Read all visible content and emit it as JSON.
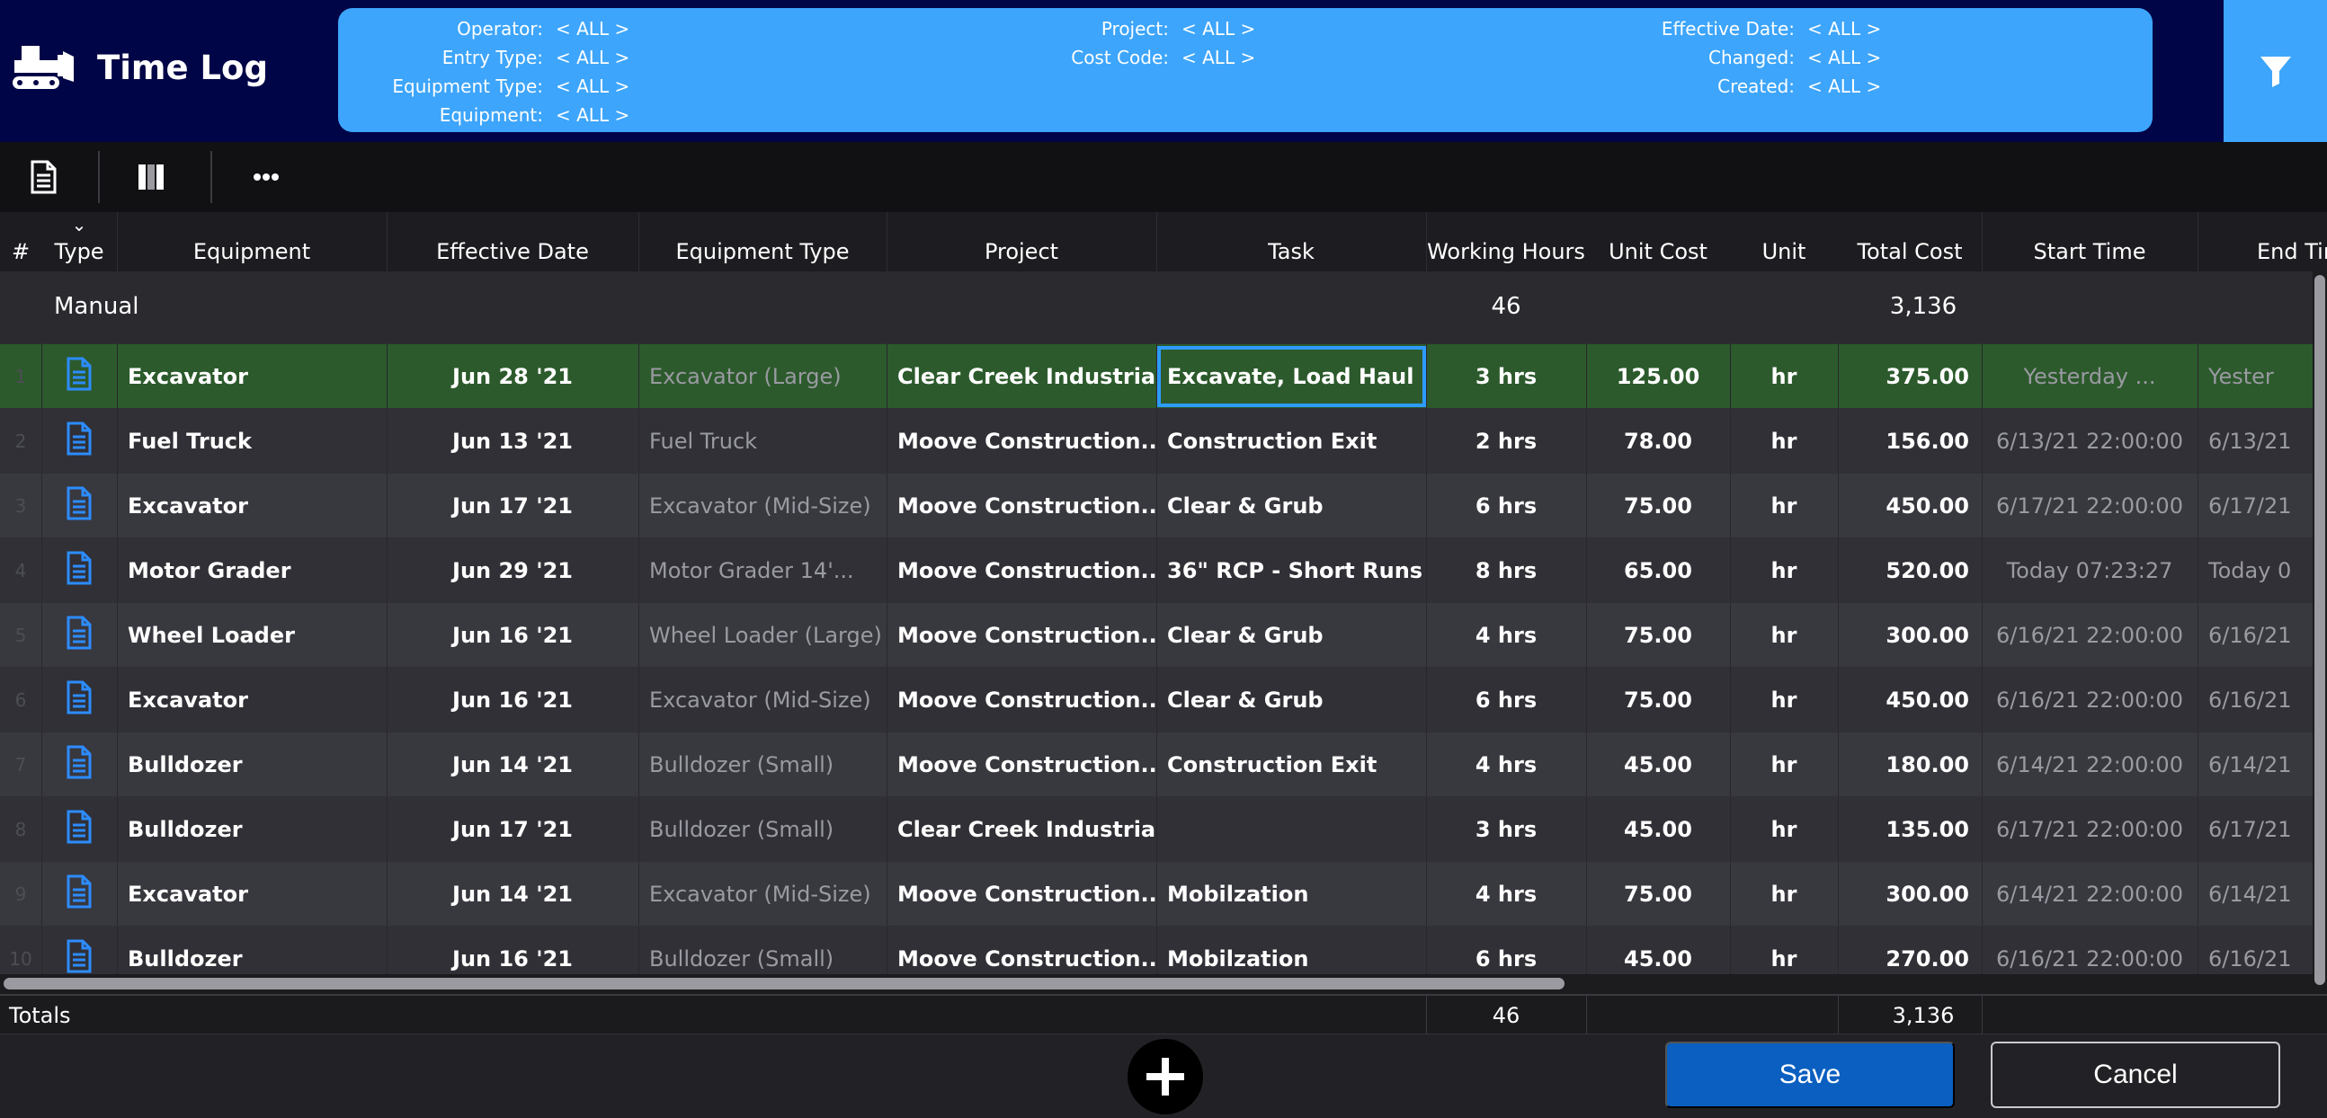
{
  "app": {
    "title": "Time Log"
  },
  "filters": {
    "col1": [
      {
        "label": "Operator:",
        "value": "< ALL >"
      },
      {
        "label": "Entry Type:",
        "value": "< ALL >"
      },
      {
        "label": "Equipment Type:",
        "value": "< ALL >"
      },
      {
        "label": "Equipment:",
        "value": "< ALL >"
      }
    ],
    "col2": [
      {
        "label": "Project:",
        "value": "< ALL >"
      },
      {
        "label": "Cost Code:",
        "value": "< ALL >"
      }
    ],
    "col3": [
      {
        "label": "Effective Date:",
        "value": "< ALL >"
      },
      {
        "label": "Changed:",
        "value": "< ALL >"
      },
      {
        "label": "Created:",
        "value": "< ALL >"
      }
    ]
  },
  "toolbar": {
    "icons": [
      "report-icon",
      "columns-icon",
      "more-icon"
    ]
  },
  "columns": {
    "num": "#",
    "type": "Type",
    "equipment": "Equipment",
    "effective_date": "Effective Date",
    "equipment_type": "Equipment Type",
    "project": "Project",
    "task": "Task",
    "working_hours": "Working Hours",
    "unit_cost": "Unit Cost",
    "unit": "Unit",
    "total_cost": "Total Cost",
    "start_time": "Start Time",
    "end_time": "End Tin"
  },
  "group": {
    "label": "Manual",
    "hours": "46",
    "total": "3,136"
  },
  "rows": [
    {
      "num": "1",
      "equipment": "Excavator",
      "date": "Jun 28 '21",
      "eqtype": "Excavator (Large)",
      "project": "Clear Creek Industrial...",
      "task": "Excavate, Load Haul &...",
      "hours": "3 hrs",
      "unit_cost": "125.00",
      "unit": "hr",
      "total": "375.00",
      "start": "Yesterday   ...",
      "end": "Yester"
    },
    {
      "num": "2",
      "equipment": "Fuel Truck",
      "date": "Jun 13 '21",
      "eqtype": "Fuel Truck",
      "project": "Moove Construction...",
      "task": "Construction Exit",
      "hours": "2 hrs",
      "unit_cost": "78.00",
      "unit": "hr",
      "total": "156.00",
      "start": "6/13/21  22:00:00",
      "end": "6/13/21"
    },
    {
      "num": "3",
      "equipment": "Excavator",
      "date": "Jun 17 '21",
      "eqtype": "Excavator (Mid-Size)",
      "project": "Moove Construction...",
      "task": "Clear & Grub",
      "hours": "6 hrs",
      "unit_cost": "75.00",
      "unit": "hr",
      "total": "450.00",
      "start": "6/17/21  22:00:00",
      "end": "6/17/21"
    },
    {
      "num": "4",
      "equipment": "Motor Grader",
      "date": "Jun 29 '21",
      "eqtype": "Motor Grader 14'...",
      "project": "Moove Construction...",
      "task": "36\" RCP - Short Runs",
      "hours": "8 hrs",
      "unit_cost": "65.00",
      "unit": "hr",
      "total": "520.00",
      "start": "Today  07:23:27",
      "end": "Today  0"
    },
    {
      "num": "5",
      "equipment": "Wheel Loader",
      "date": "Jun 16 '21",
      "eqtype": "Wheel Loader (Large)",
      "project": "Moove Construction...",
      "task": "Clear & Grub",
      "hours": "4 hrs",
      "unit_cost": "75.00",
      "unit": "hr",
      "total": "300.00",
      "start": "6/16/21  22:00:00",
      "end": "6/16/21"
    },
    {
      "num": "6",
      "equipment": "Excavator",
      "date": "Jun 16 '21",
      "eqtype": "Excavator (Mid-Size)",
      "project": "Moove Construction...",
      "task": "Clear & Grub",
      "hours": "6 hrs",
      "unit_cost": "75.00",
      "unit": "hr",
      "total": "450.00",
      "start": "6/16/21  22:00:00",
      "end": "6/16/21"
    },
    {
      "num": "7",
      "equipment": "Bulldozer",
      "date": "Jun 14 '21",
      "eqtype": "Bulldozer (Small)",
      "project": "Moove Construction...",
      "task": "Construction Exit",
      "hours": "4 hrs",
      "unit_cost": "45.00",
      "unit": "hr",
      "total": "180.00",
      "start": "6/14/21  22:00:00",
      "end": "6/14/21"
    },
    {
      "num": "8",
      "equipment": "Bulldozer",
      "date": "Jun 17 '21",
      "eqtype": "Bulldozer (Small)",
      "project": "Clear Creek Industrial...",
      "task": "",
      "hours": "3 hrs",
      "unit_cost": "45.00",
      "unit": "hr",
      "total": "135.00",
      "start": "6/17/21  22:00:00",
      "end": "6/17/21"
    },
    {
      "num": "9",
      "equipment": "Excavator",
      "date": "Jun 14 '21",
      "eqtype": "Excavator (Mid-Size)",
      "project": "Moove Construction...",
      "task": "Mobilzation",
      "hours": "4 hrs",
      "unit_cost": "75.00",
      "unit": "hr",
      "total": "300.00",
      "start": "6/14/21  22:00:00",
      "end": "6/14/21"
    },
    {
      "num": "10",
      "equipment": "Bulldozer",
      "date": "Jun 16 '21",
      "eqtype": "Bulldozer (Small)",
      "project": "Moove Construction...",
      "task": "Mobilzation",
      "hours": "6 hrs",
      "unit_cost": "45.00",
      "unit": "hr",
      "total": "270.00",
      "start": "6/16/21  22:00:00",
      "end": "6/16/21"
    }
  ],
  "totals": {
    "label": "Totals",
    "hours": "46",
    "total": "3,136"
  },
  "footer": {
    "save_label": "Save",
    "cancel_label": "Cancel"
  },
  "colors": {
    "header_bg": "#000547",
    "filter_bg": "#3da5fb",
    "selected_row": "#2c5a2c",
    "save_bg": "#0a5fc0",
    "icon_blue": "#2d8cff"
  }
}
